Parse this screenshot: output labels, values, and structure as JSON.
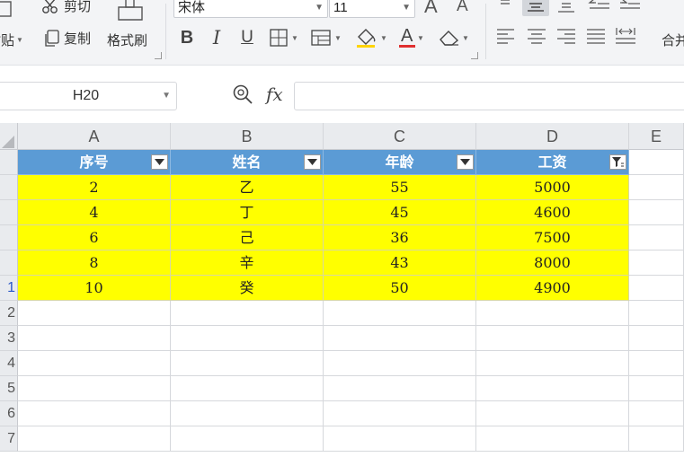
{
  "ribbon": {
    "clipboard": {
      "paste_label": "粘贴",
      "cut_label": "剪切",
      "copy_label": "复制",
      "format_painter_label": "格式刷"
    },
    "font": {
      "font_name": "宋体",
      "font_size": "11",
      "bold_label": "B",
      "italic_label": "I",
      "underline_label": "U",
      "font_color_label": "A",
      "increase_size_label": "A",
      "decrease_size_label": "A"
    },
    "alignment": {
      "merge_label": "合并"
    },
    "colors": {
      "font_color": "#e03030",
      "fill_color": "#ffd400"
    }
  },
  "formula_bar": {
    "cell_reference": "H20",
    "fx_label": "fx",
    "formula_value": ""
  },
  "grid": {
    "columns": [
      "A",
      "B",
      "C",
      "D",
      "E"
    ],
    "header_row": {
      "row_number": "",
      "cells": [
        "序号",
        "姓名",
        "年龄",
        "工资"
      ]
    },
    "data_rows": [
      {
        "row_number": "",
        "cells": [
          "2",
          "乙",
          "55",
          "5000"
        ]
      },
      {
        "row_number": "",
        "cells": [
          "4",
          "丁",
          "45",
          "4600"
        ]
      },
      {
        "row_number": "",
        "cells": [
          "6",
          "己",
          "36",
          "7500"
        ]
      },
      {
        "row_number": "",
        "cells": [
          "8",
          "辛",
          "43",
          "8000"
        ]
      },
      {
        "row_number": "1",
        "cells": [
          "10",
          "癸",
          "50",
          "4900"
        ]
      }
    ],
    "empty_rows": [
      "2",
      "3",
      "4",
      "5",
      "6",
      "7"
    ],
    "header_fill_color": "#5b9bd5",
    "highlight_fill_color": "#ffff00",
    "filter_active_column": "D"
  }
}
